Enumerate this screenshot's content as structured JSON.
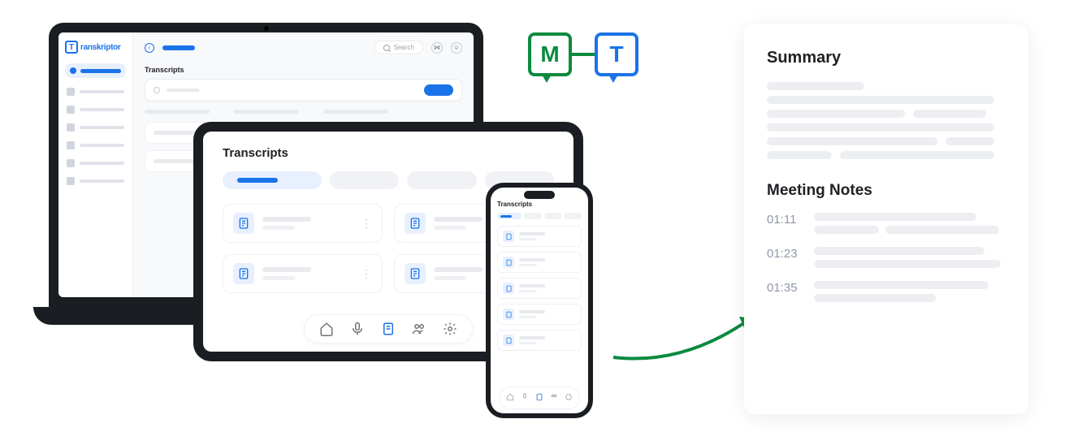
{
  "brand": {
    "name": "ranskriptor",
    "initial": "T"
  },
  "search": {
    "placeholder": "Search"
  },
  "laptop": {
    "section_title": "Transcripts"
  },
  "tablet": {
    "section_title": "Transcripts"
  },
  "phone": {
    "section_title": "Transcripts"
  },
  "connector": {
    "left_label": "M",
    "right_label": "T"
  },
  "summary": {
    "heading": "Summary",
    "notes_heading": "Meeting Notes",
    "notes": [
      {
        "time": "01:11"
      },
      {
        "time": "01:23"
      },
      {
        "time": "01:35"
      }
    ]
  },
  "colors": {
    "primary": "#1a73e8",
    "green": "#0b8a3e"
  }
}
